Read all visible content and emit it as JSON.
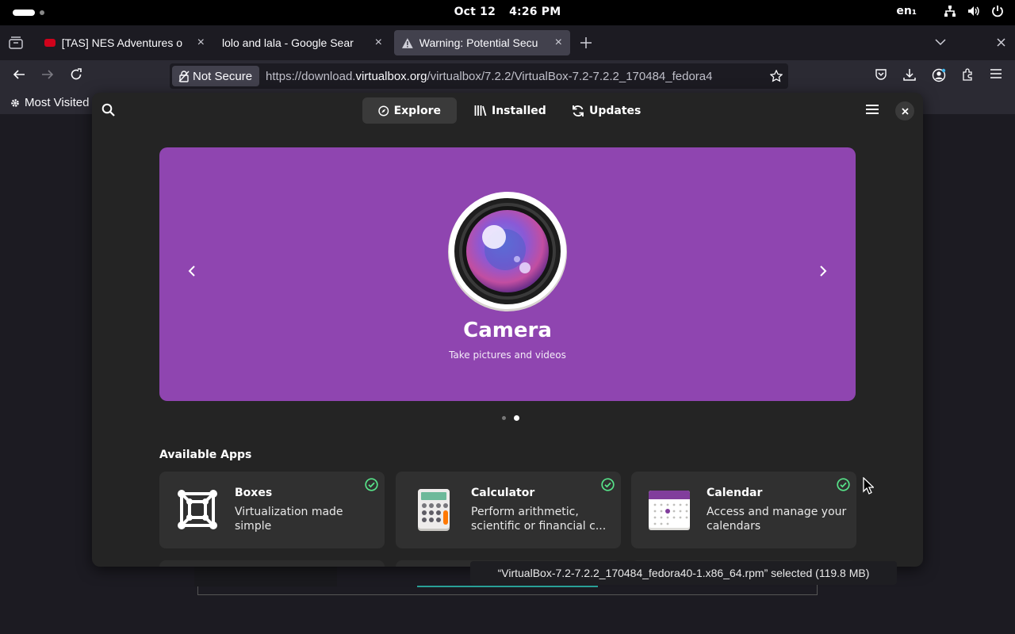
{
  "topbar": {
    "date": "Oct 12",
    "time": "4:26 PM",
    "language": "en₁"
  },
  "browser": {
    "tabs": [
      {
        "title": "[TAS] NES Adventures o",
        "icon": "youtube-icon",
        "active": false
      },
      {
        "title": "lolo and lala - Google Sear",
        "icon": "",
        "active": false
      },
      {
        "title": "Warning: Potential Secu",
        "icon": "warning-icon",
        "active": true
      }
    ],
    "not_secure_label": "Not Secure",
    "url_prefix": "https://download.",
    "url_domain": "virtualbox.org",
    "url_rest": "/virtualbox/7.2.2/VirtualBox-7.2-7.2.2_170484_fedora4",
    "bookmark_label": "Most Visited"
  },
  "software": {
    "nav": {
      "explore": "Explore",
      "installed": "Installed",
      "updates": "Updates"
    },
    "banner": {
      "title": "Camera",
      "subtitle": "Take pictures and videos",
      "background": "#8f45b0",
      "page_count": 2,
      "current_page": 2
    },
    "section_title": "Available Apps",
    "apps": [
      {
        "name": "Boxes",
        "description": "Virtualization made simple",
        "icon": "boxes-icon",
        "installed": true
      },
      {
        "name": "Calculator",
        "description": "Perform arithmetic, scientific or financial c...",
        "icon": "calculator-icon",
        "installed": true
      },
      {
        "name": "Calendar",
        "description": "Access and manage your calendars",
        "icon": "calendar-icon",
        "installed": true
      }
    ]
  },
  "status_popup": "“VirtualBox-7.2-7.2.2_170484_fedora40-1.x86_64.rpm” selected  (119.8 MB)"
}
